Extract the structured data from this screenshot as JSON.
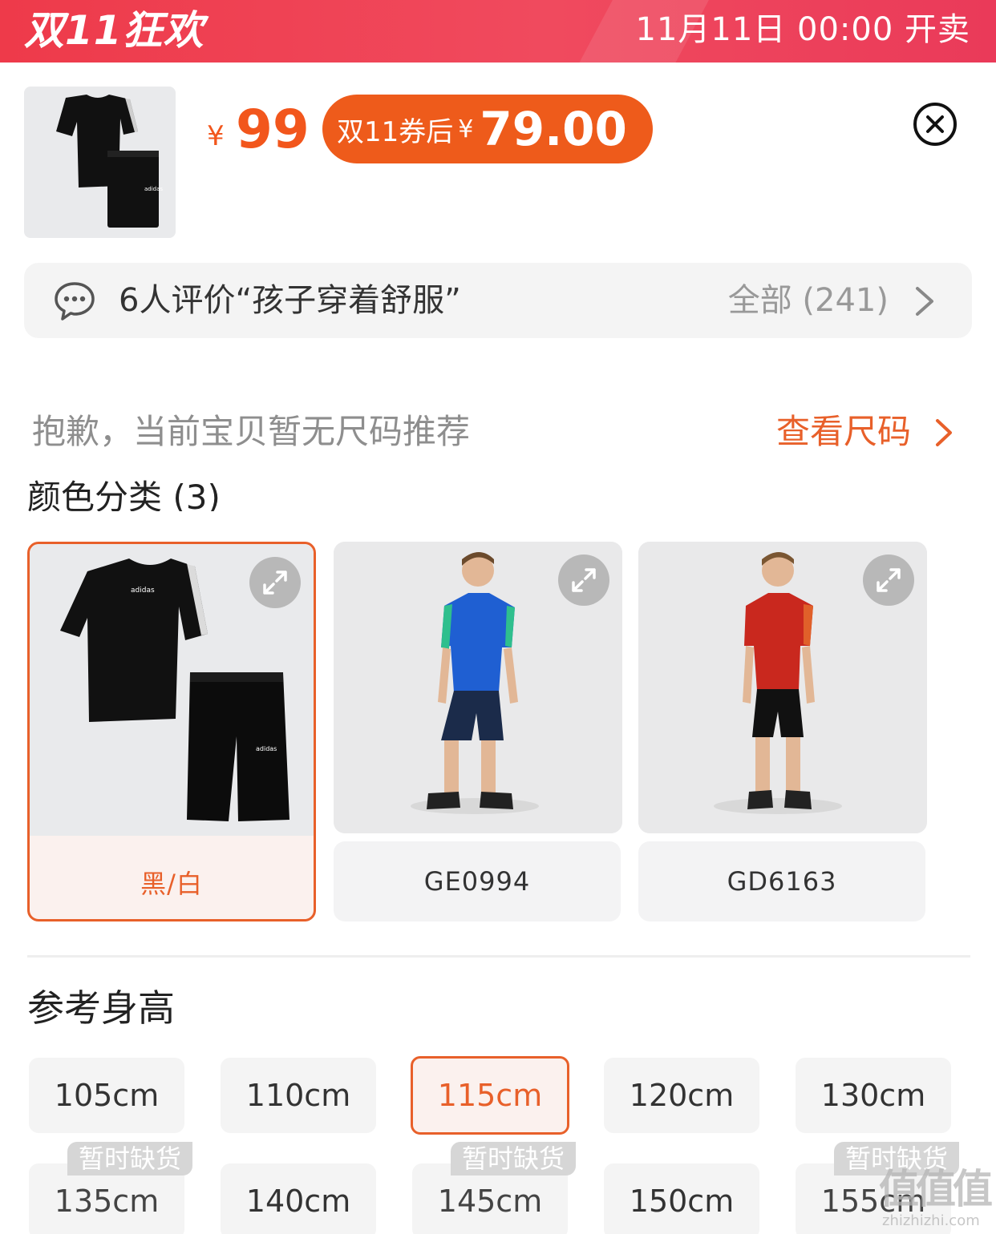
{
  "banner": {
    "title": "双11狂欢",
    "sale_time": "11月11日 00:00 开卖"
  },
  "product": {
    "thumbnail_icon": "black-tshirt-shorts-set-image",
    "price_symbol": "¥",
    "price": "99",
    "coupon_label": "双11券后",
    "coupon_symbol": "¥",
    "coupon_price": "79.00",
    "close_icon": "close-circle-icon"
  },
  "review": {
    "icon": "chat-bubble-icon",
    "summary": "6人评价“孩子穿着舒服”",
    "all_label": "全部 (241)",
    "chevron_icon": "chevron-right-icon"
  },
  "size_recommendation": {
    "message": "抱歉，当前宝贝暂无尺码推荐",
    "link_label": "查看尺码",
    "chevron_icon": "chevron-right-icon"
  },
  "color_section": {
    "title": "颜色分类 (3)",
    "options": [
      {
        "label": "黑/白",
        "image": "black-set-product-image",
        "selected": true
      },
      {
        "label": "GE0994",
        "image": "boy-blue-shirt-model-image",
        "selected": false
      },
      {
        "label": "GD6163",
        "image": "boy-red-shirt-model-image",
        "selected": false
      }
    ],
    "expand_icon": "expand-arrows-icon"
  },
  "height_section": {
    "title": "参考身高",
    "sizes": [
      {
        "label": "105cm",
        "selected": false
      },
      {
        "label": "110cm",
        "selected": false
      },
      {
        "label": "115cm",
        "selected": true
      },
      {
        "label": "120cm",
        "selected": false
      },
      {
        "label": "130cm",
        "selected": false
      },
      {
        "label": "135cm",
        "selected": false,
        "tag": "暂时缺货"
      },
      {
        "label": "140cm",
        "selected": false
      },
      {
        "label": "145cm",
        "selected": false,
        "tag": "暂时缺货"
      },
      {
        "label": "150cm",
        "selected": false
      },
      {
        "label": "155cm",
        "selected": false,
        "tag": "暂时缺货"
      }
    ]
  },
  "watermark": {
    "brand": "值值值",
    "domain": "zhizhizhi.com"
  },
  "colors": {
    "banner": "#ee3a4a",
    "accent": "#f2561c",
    "selected_border": "#e8602a",
    "chip_bg": "#f4f4f4"
  }
}
